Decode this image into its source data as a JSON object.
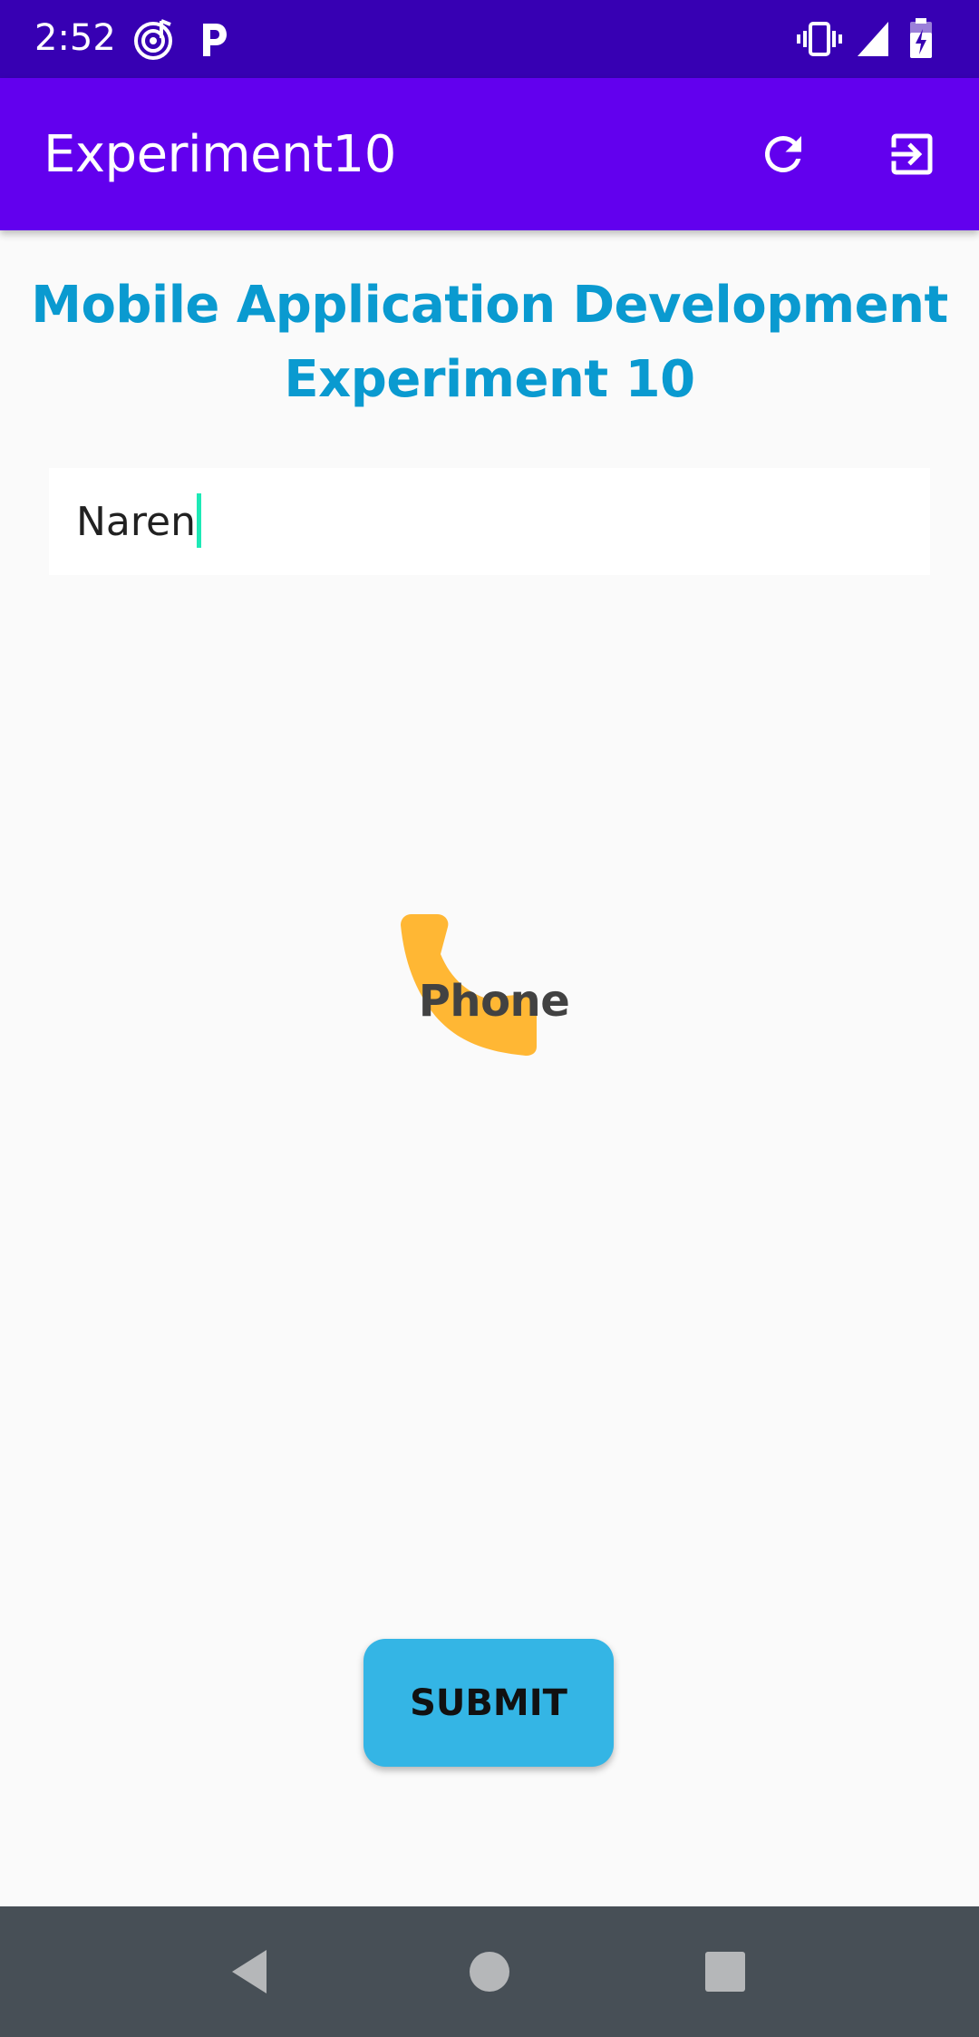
{
  "status_bar": {
    "time": "2:52",
    "icons": [
      "music-notification-icon",
      "parking-notification-icon",
      "vibrate-icon",
      "signal-icon",
      "battery-charging-icon"
    ]
  },
  "app_bar": {
    "title": "Experiment10",
    "actions": [
      "refresh-icon",
      "exit-icon"
    ],
    "background": "#6200ee"
  },
  "content": {
    "heading_line1": "Mobile Application Development",
    "heading_line2": "Experiment 10",
    "name_input_value": "Naren",
    "phone_label": "Phone",
    "phone_icon": "phone-icon",
    "submit_label": "SUBMIT",
    "accent_color": "#34b5e5",
    "heading_color": "#0a9ad0",
    "phone_icon_color": "#ffb734"
  },
  "nav_bar": {
    "buttons": [
      "back-icon",
      "home-icon",
      "recents-icon"
    ]
  }
}
